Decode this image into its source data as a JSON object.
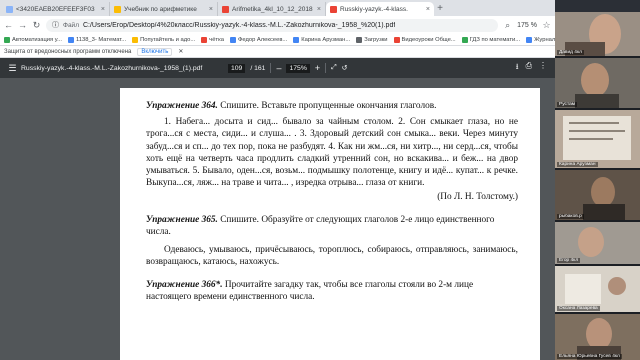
{
  "tabs": [
    {
      "label": "<3420EAEB20EFEEF3F03",
      "active": false,
      "color": "#8ab4f8"
    },
    {
      "label": "Учебник по арифметике",
      "active": false,
      "color": "#fbbc04"
    },
    {
      "label": "Arifmetika_4kl_10_12_2018",
      "active": false,
      "color": "#ea4335"
    },
    {
      "label": "Russkiy-yazyk.-4-klass.",
      "active": true,
      "color": "#ea4335"
    }
  ],
  "new_tab_label": "+",
  "toolbar": {
    "url": "C:/Users/Егор/Desktop/4%20класс/Russkiy-yazyk.-4-klass.-M.L.-Zakozhurnikova-_1958_%20(1).pdf",
    "scheme": "Файл",
    "zoom": "175 %"
  },
  "bookmarks": [
    {
      "label": "Автоматизация у...",
      "color": "#34a853"
    },
    {
      "label": "1138_3- Математ...",
      "color": "#4285f4"
    },
    {
      "label": "Попугайтель и адо...",
      "color": "#fbbc04"
    },
    {
      "label": "чётка",
      "color": "#ea4335"
    },
    {
      "label": "Федор Алексеев...",
      "color": "#4285f4"
    },
    {
      "label": "Карина Арузман...",
      "color": "#4285f4"
    },
    {
      "label": "Загрузки",
      "color": "#5f6368"
    },
    {
      "label": "Видеоуроки Обще...",
      "color": "#ea4335"
    },
    {
      "label": "ГДЗ по математи...",
      "color": "#34a853"
    },
    {
      "label": "Журналы - Днев...",
      "color": "#4285f4"
    }
  ],
  "infobar": {
    "text": "Защита от вредоносных программ отключена",
    "button": "Включить"
  },
  "pdf": {
    "filename": "Russkiy-yazyk.-4-klass.-M.L.-Zakozhurnikova-_1958_(1).pdf",
    "page_current": "109",
    "page_total": "/ 161",
    "zoom": "175%",
    "minus": "–",
    "plus": "+"
  },
  "page": {
    "ex364_title": "Упражнение 364.",
    "ex364_instr": " Спишите. Вставьте пропущенные окончания глаголов.",
    "ex364_text": "1. Набега... досыта и сид... бывало за чайным столом. 2. Сон смыкает глаза, но не трога...ся с места, сиди... и слуша... . 3. Здоровый детский сон смыка... веки. Через минуту забуд...ся и сп... до тех пор, пока не разбудят. 4. Как ни жм...ся, ни хитр..., ни серд...ся, чтобы хоть ещё на четверть часа продлить сладкий утренний сон, но вскакива... и беж... на двор умываться. 5. Бывало, оден...ся, возьм... подмышку полотенце, книгу и идё... купат... к речке. Выкупа...ся, ляж... на траве и чита... , изредка отрыва... глаза от книги.",
    "ex364_author": "(По Л. Н. Толстому.)",
    "ex365_title": "Упражнение 365.",
    "ex365_instr": " Спишите. Образуйте от следующих глаголов 2-е лицо единственного числа.",
    "ex365_text": "Одеваюсь, умываюсь, причёсываюсь, тороплюсь, собираюсь, отправляюсь, занимаюсь, возвращаюсь, катаюсь, нахожусь.",
    "ex366_title": "Упражнение 366*.",
    "ex366_instr": " Прочитайте загадку так, чтобы все глаголы стояли во 2-м лице настоящего времени единственного числа."
  },
  "participants": [
    {
      "name": "Давид 4кл",
      "bg": "#9a8f84"
    },
    {
      "name": "Рустам",
      "bg": "#6f6a63"
    },
    {
      "name": "Карина Арузман",
      "bg": "#b8a99a"
    },
    {
      "name": "рыбаков.р",
      "bg": "#5f5348"
    },
    {
      "name": "Егор 4кл",
      "bg": "#a09a92"
    },
    {
      "name": "Оксана Лазарева",
      "bg": "#d8d2c8"
    },
    {
      "name": "Ельяна Юрьевна Гусев 4кл",
      "bg": "#7e6f5f"
    }
  ]
}
